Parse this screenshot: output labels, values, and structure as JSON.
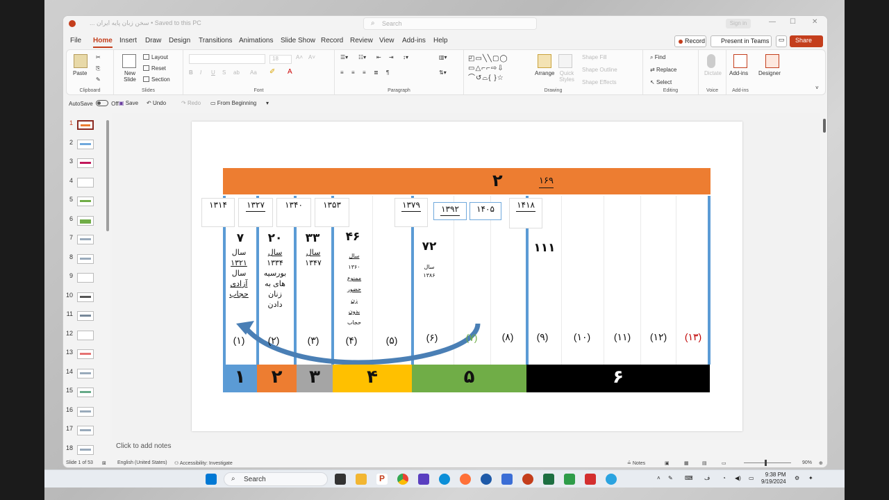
{
  "title_bar": {
    "doc_title": "... سخن زبان پایه ایران  •  Saved to this PC",
    "search_placeholder": "Search",
    "sign_in": "Sign in"
  },
  "menu": {
    "tabs": [
      "File",
      "Home",
      "Insert",
      "Draw",
      "Design",
      "Transitions",
      "Animations",
      "Slide Show",
      "Record",
      "Review",
      "View",
      "Add-ins",
      "Help"
    ],
    "active": "Home",
    "record_label": "Record",
    "teams_label": "Present in Teams",
    "share_label": "Share"
  },
  "ribbon": {
    "clipboard": {
      "paste": "Paste",
      "label": "Clipboard"
    },
    "slides": {
      "new_slide": "New Slide",
      "layout": "Layout",
      "reset": "Reset",
      "section": "Section",
      "label": "Slides"
    },
    "font": {
      "label": "Font",
      "size": "18"
    },
    "paragraph": {
      "label": "Paragraph"
    },
    "drawing": {
      "arrange": "Arrange",
      "quick_styles": "Quick Styles",
      "shape_fill": "Shape Fill",
      "shape_outline": "Shape Outline",
      "shape_effects": "Shape Effects",
      "label": "Drawing"
    },
    "editing": {
      "find": "Find",
      "replace": "Replace",
      "select": "Select",
      "label": "Editing"
    },
    "voice": {
      "dictate": "Dictate",
      "label": "Voice"
    },
    "addins": {
      "addins": "Add-ins",
      "designer": "Designer",
      "label": "Add-ins"
    }
  },
  "quick_access": {
    "autosave": "AutoSave",
    "autosave_state": "Off",
    "save": "Save",
    "undo": "Undo",
    "redo": "Redo",
    "from_beginning": "From Beginning"
  },
  "thumbnails": [
    "1",
    "2",
    "3",
    "4",
    "5",
    "6",
    "7",
    "8",
    "9",
    "10",
    "11",
    "12",
    "13",
    "14",
    "15",
    "16",
    "17",
    "18"
  ],
  "current_slide": "1",
  "slide": {
    "banner_main": "۲",
    "banner_sub": "۱۶۹",
    "years": [
      "۱۳۱۴",
      "۱۳۲۷",
      "۱۳۴۰",
      "۱۳۵۳",
      "۱۳۷۹",
      "۱۳۹۲",
      "۱۴۰۵",
      "۱۴۱۸"
    ],
    "col_values": [
      "۷",
      "۲۰",
      "۳۳",
      "۴۶",
      "۷۲",
      "۱۱۱"
    ],
    "col1_text": [
      "سال",
      "۱۳۲۱",
      "سال",
      "آزادی",
      "حجاب"
    ],
    "col2_text": [
      "سال",
      "۱۳۳۴",
      "بورسیه",
      "های به",
      "زنان",
      "دادن"
    ],
    "col3_text": [
      "سال",
      "۱۳۴۷"
    ],
    "col4_text": [
      "سال",
      "۱۳۶۰",
      "ممنوع",
      "حضور",
      "زن",
      "بدون",
      "حجاب"
    ],
    "col5_text": [
      "سال",
      "۱۳۸۶"
    ],
    "indices": [
      "(۱)",
      "(۲)",
      "(۳)",
      "(۴)",
      "(۵)",
      "(۶)",
      "(۷)",
      "(۸)",
      "(۹)",
      "(۱۰)",
      "(۱۱)",
      "(۱۲)",
      "(۱۳)"
    ],
    "eras": [
      "۱",
      "۲",
      "۳",
      "۴",
      "۵",
      "۶"
    ],
    "era_colors": [
      "#5b9bd5",
      "#ed7d31",
      "#a5a5a5",
      "#ffc000",
      "#70ad47",
      "#000000"
    ]
  },
  "notes_placeholder": "Click to add notes",
  "status": {
    "slide_of": "Slide 1 of 53",
    "language": "English (United States)",
    "accessibility": "Accessibility: Investigate",
    "notes": "Notes",
    "zoom": "90%"
  },
  "taskbar": {
    "search": "Search",
    "time": "9:38 PM",
    "date": "9/19/2024"
  }
}
